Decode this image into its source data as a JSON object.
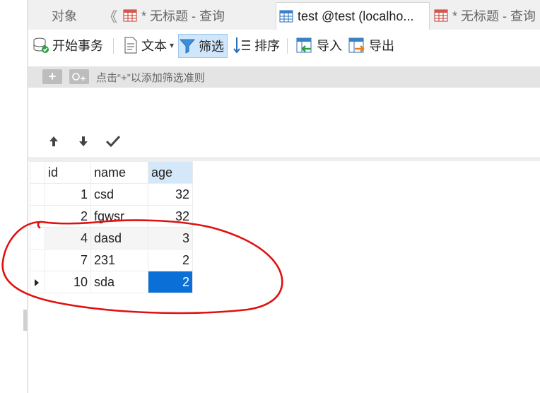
{
  "tabs": {
    "objects": "对象",
    "items": [
      {
        "label": "* 无标题 - 查询"
      },
      {
        "label": "test @test (localho..."
      },
      {
        "label": "* 无标题 - 查询"
      }
    ]
  },
  "toolbar": {
    "begin_transaction": "开始事务",
    "text": "文本",
    "text_arrow": "▾",
    "filter": "筛选",
    "sort": "排序",
    "import": "导入",
    "export": "导出"
  },
  "filter_bar": {
    "hint": "点击“+”以添加筛选准则"
  },
  "grid": {
    "columns": [
      "id",
      "name",
      "age"
    ],
    "rows": [
      {
        "id": "1",
        "name": "csd",
        "age": "32"
      },
      {
        "id": "2",
        "name": "fgwsr",
        "age": "32"
      },
      {
        "id": "4",
        "name": "dasd",
        "age": "3"
      },
      {
        "id": "7",
        "name": "231",
        "age": "2"
      },
      {
        "id": "10",
        "name": "sda",
        "age": "2"
      }
    ]
  },
  "colors": {
    "accent": "#0a6fd6",
    "annotation": "#e01010",
    "filter_active": "#cfe6fb"
  },
  "icons": [
    "table-icon",
    "database-transaction-icon",
    "text-doc-icon",
    "filter-icon",
    "sort-icon",
    "import-icon",
    "export-icon",
    "add-icon",
    "add-filter-icon",
    "arrow-up-icon",
    "arrow-down-icon",
    "check-icon"
  ]
}
